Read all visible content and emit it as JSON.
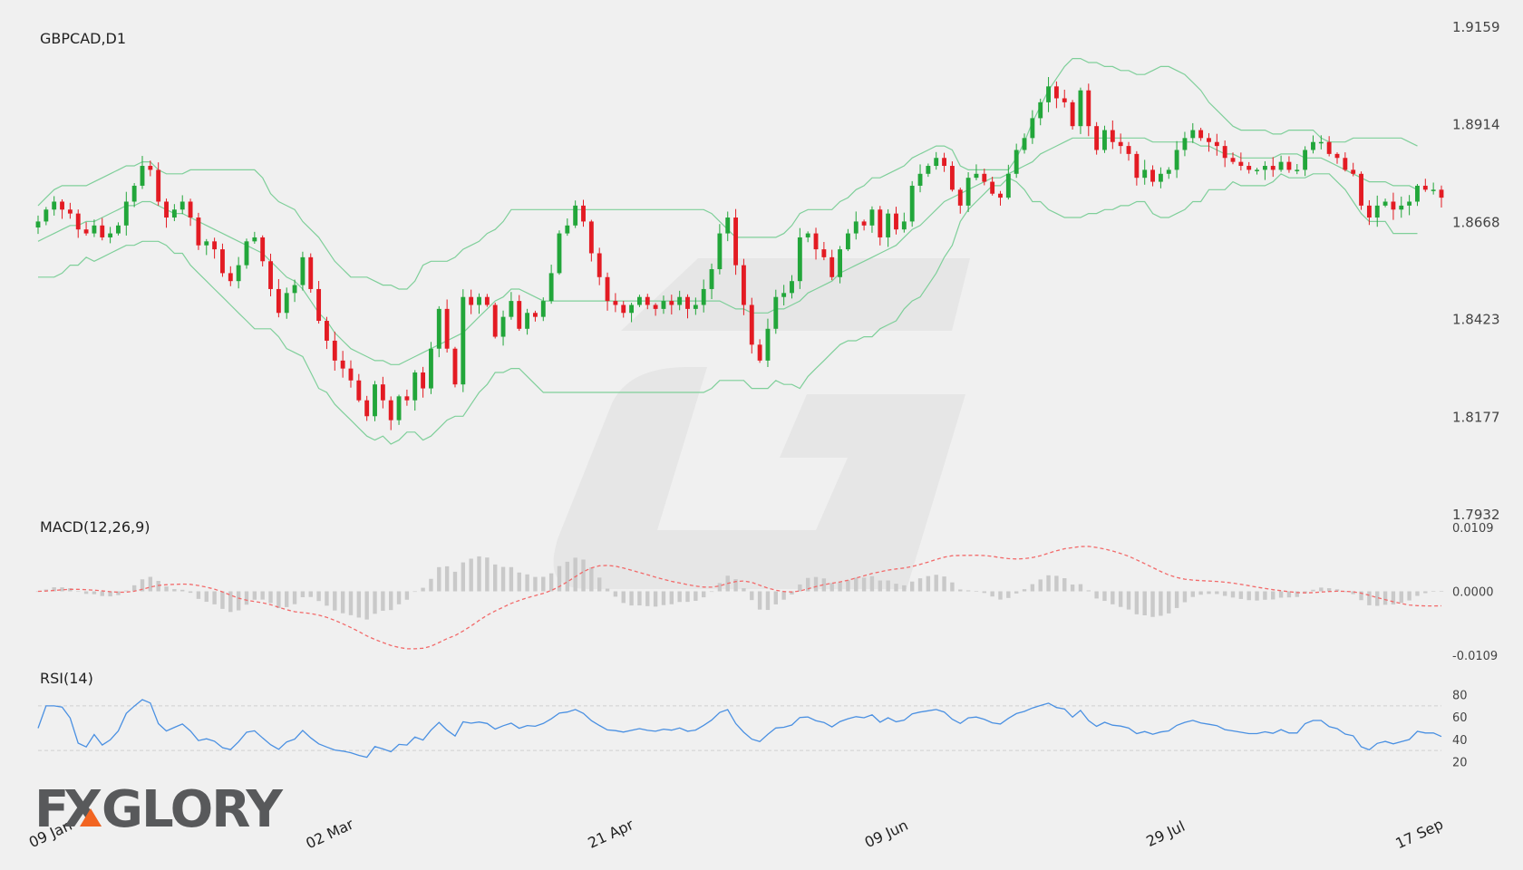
{
  "chart_data": {
    "type": "candlestick",
    "title": "GBPCAD,D1",
    "price_axis": {
      "ticks": [
        "1.9159",
        "1.8914",
        "1.8668",
        "1.8423",
        "1.8177",
        "1.7932"
      ],
      "ylim": [
        1.7932,
        1.9159
      ]
    },
    "x_ticks": [
      "09 Jan",
      "02 Mar",
      "21 Apr",
      "09 Jun",
      "29 Jul",
      "17 Sep"
    ],
    "series": [
      {
        "name": "close",
        "values": [
          1.867,
          1.87,
          1.872,
          1.87,
          1.869,
          1.865,
          1.864,
          1.866,
          1.863,
          1.864,
          1.866,
          1.872,
          1.876,
          1.881,
          1.88,
          1.872,
          1.868,
          1.87,
          1.872,
          1.868,
          1.861,
          1.862,
          1.86,
          1.854,
          1.852,
          1.856,
          1.862,
          1.863,
          1.857,
          1.85,
          1.844,
          1.849,
          1.851,
          1.858,
          1.85,
          1.842,
          1.837,
          1.832,
          1.83,
          1.827,
          1.822,
          1.818,
          1.826,
          1.822,
          1.817,
          1.823,
          1.822,
          1.829,
          1.825,
          1.835,
          1.845,
          1.835,
          1.826,
          1.848,
          1.846,
          1.848,
          1.846,
          1.838,
          1.843,
          1.847,
          1.84,
          1.844,
          1.843,
          1.847,
          1.854,
          1.864,
          1.866,
          1.871,
          1.867,
          1.859,
          1.853,
          1.847,
          1.846,
          1.844,
          1.846,
          1.848,
          1.846,
          1.845,
          1.847,
          1.846,
          1.848,
          1.845,
          1.846,
          1.85,
          1.855,
          1.864,
          1.868,
          1.856,
          1.846,
          1.836,
          1.832,
          1.84,
          1.848,
          1.849,
          1.852,
          1.863,
          1.864,
          1.86,
          1.858,
          1.853,
          1.86,
          1.864,
          1.867,
          1.866,
          1.87,
          1.863,
          1.869,
          1.865,
          1.867,
          1.876,
          1.879,
          1.881,
          1.883,
          1.881,
          1.875,
          1.871,
          1.878,
          1.879,
          1.877,
          1.874,
          1.873,
          1.879,
          1.885,
          1.888,
          1.893,
          1.897,
          1.901,
          1.898,
          1.897,
          1.891,
          1.9,
          1.891,
          1.885,
          1.89,
          1.887,
          1.886,
          1.884,
          1.878,
          1.88,
          1.877,
          1.879,
          1.88,
          1.885,
          1.888,
          1.89,
          1.888,
          1.887,
          1.886,
          1.883,
          1.882,
          1.881,
          1.88,
          1.88,
          1.881,
          1.88,
          1.882,
          1.88,
          1.88,
          1.885,
          1.887,
          1.887,
          1.884,
          1.883,
          1.88,
          1.879,
          1.871,
          1.868,
          1.871,
          1.872,
          1.87,
          1.871,
          1.872,
          1.876,
          1.875,
          1.875,
          1.873
        ]
      }
    ],
    "bollinger_bands": {
      "upper": [
        1.871,
        1.873,
        1.875,
        1.876,
        1.876,
        1.876,
        1.876,
        1.877,
        1.878,
        1.879,
        1.88,
        1.881,
        1.881,
        1.882,
        1.882,
        1.88,
        1.879,
        1.879,
        1.879,
        1.88,
        1.88,
        1.88,
        1.88,
        1.88,
        1.88,
        1.88,
        1.88,
        1.88,
        1.878,
        1.874,
        1.872,
        1.871,
        1.87,
        1.867,
        1.865,
        1.863,
        1.86,
        1.857,
        1.855,
        1.853,
        1.853,
        1.853,
        1.852,
        1.851,
        1.851,
        1.85,
        1.85,
        1.852,
        1.856,
        1.857,
        1.857,
        1.857,
        1.858,
        1.86,
        1.861,
        1.862,
        1.864,
        1.865,
        1.867,
        1.87,
        1.87,
        1.87,
        1.87,
        1.87,
        1.87,
        1.87,
        1.87,
        1.87,
        1.87,
        1.87,
        1.87,
        1.87,
        1.87,
        1.87,
        1.87,
        1.87,
        1.87,
        1.87,
        1.87,
        1.87,
        1.87,
        1.87,
        1.87,
        1.87,
        1.869,
        1.867,
        1.865,
        1.863,
        1.863,
        1.863,
        1.863,
        1.863,
        1.863,
        1.864,
        1.866,
        1.869,
        1.87,
        1.87,
        1.87,
        1.87,
        1.872,
        1.873,
        1.875,
        1.876,
        1.878,
        1.878,
        1.879,
        1.88,
        1.881,
        1.883,
        1.884,
        1.885,
        1.886,
        1.886,
        1.885,
        1.881,
        1.88,
        1.88,
        1.88,
        1.88,
        1.88,
        1.88,
        1.883,
        1.887,
        1.892,
        1.896,
        1.9,
        1.903,
        1.906,
        1.908,
        1.908,
        1.907,
        1.907,
        1.906,
        1.906,
        1.905,
        1.905,
        1.904,
        1.904,
        1.905,
        1.906,
        1.906,
        1.905,
        1.904,
        1.902,
        1.9,
        1.897,
        1.895,
        1.893,
        1.891,
        1.89,
        1.89,
        1.89,
        1.89,
        1.889,
        1.889,
        1.89,
        1.89,
        1.89,
        1.89,
        1.888,
        1.887,
        1.887,
        1.887,
        1.888,
        1.888,
        1.888,
        1.888,
        1.888,
        1.888,
        1.888,
        1.887,
        1.886
      ],
      "middle": [
        1.862,
        1.863,
        1.864,
        1.865,
        1.866,
        1.866,
        1.867,
        1.867,
        1.868,
        1.869,
        1.87,
        1.871,
        1.871,
        1.872,
        1.872,
        1.871,
        1.87,
        1.869,
        1.869,
        1.868,
        1.867,
        1.866,
        1.865,
        1.864,
        1.863,
        1.862,
        1.861,
        1.86,
        1.859,
        1.857,
        1.855,
        1.853,
        1.852,
        1.85,
        1.847,
        1.844,
        1.842,
        1.839,
        1.837,
        1.835,
        1.834,
        1.833,
        1.832,
        1.832,
        1.831,
        1.831,
        1.832,
        1.833,
        1.834,
        1.835,
        1.836,
        1.837,
        1.838,
        1.839,
        1.841,
        1.843,
        1.845,
        1.847,
        1.848,
        1.85,
        1.85,
        1.849,
        1.848,
        1.847,
        1.847,
        1.847,
        1.847,
        1.847,
        1.847,
        1.847,
        1.847,
        1.847,
        1.847,
        1.847,
        1.847,
        1.847,
        1.847,
        1.847,
        1.847,
        1.847,
        1.847,
        1.847,
        1.847,
        1.847,
        1.847,
        1.847,
        1.846,
        1.845,
        1.845,
        1.844,
        1.844,
        1.844,
        1.845,
        1.845,
        1.846,
        1.847,
        1.849,
        1.85,
        1.851,
        1.852,
        1.854,
        1.855,
        1.856,
        1.857,
        1.858,
        1.859,
        1.86,
        1.861,
        1.863,
        1.865,
        1.866,
        1.868,
        1.87,
        1.872,
        1.873,
        1.874,
        1.875,
        1.876,
        1.877,
        1.878,
        1.878,
        1.879,
        1.88,
        1.881,
        1.882,
        1.884,
        1.885,
        1.886,
        1.887,
        1.888,
        1.888,
        1.888,
        1.888,
        1.888,
        1.888,
        1.888,
        1.888,
        1.888,
        1.888,
        1.887,
        1.887,
        1.887,
        1.887,
        1.887,
        1.887,
        1.886,
        1.886,
        1.885,
        1.884,
        1.884,
        1.883,
        1.883,
        1.883,
        1.883,
        1.883,
        1.884,
        1.884,
        1.884,
        1.883,
        1.883,
        1.883,
        1.882,
        1.881,
        1.88,
        1.879,
        1.878,
        1.877,
        1.877,
        1.877,
        1.876,
        1.876,
        1.876,
        1.875
      ],
      "lower": [
        1.853,
        1.853,
        1.853,
        1.854,
        1.856,
        1.856,
        1.858,
        1.857,
        1.858,
        1.859,
        1.86,
        1.861,
        1.861,
        1.862,
        1.862,
        1.862,
        1.861,
        1.859,
        1.859,
        1.856,
        1.854,
        1.852,
        1.85,
        1.848,
        1.846,
        1.844,
        1.842,
        1.84,
        1.84,
        1.84,
        1.838,
        1.835,
        1.834,
        1.833,
        1.829,
        1.825,
        1.824,
        1.821,
        1.819,
        1.817,
        1.815,
        1.813,
        1.812,
        1.813,
        1.811,
        1.812,
        1.814,
        1.814,
        1.812,
        1.813,
        1.815,
        1.817,
        1.818,
        1.818,
        1.821,
        1.824,
        1.826,
        1.829,
        1.829,
        1.83,
        1.83,
        1.828,
        1.826,
        1.824,
        1.824,
        1.824,
        1.824,
        1.824,
        1.824,
        1.824,
        1.824,
        1.824,
        1.824,
        1.824,
        1.824,
        1.824,
        1.824,
        1.824,
        1.824,
        1.824,
        1.824,
        1.824,
        1.824,
        1.824,
        1.825,
        1.827,
        1.827,
        1.827,
        1.827,
        1.825,
        1.825,
        1.825,
        1.827,
        1.826,
        1.826,
        1.825,
        1.828,
        1.83,
        1.832,
        1.834,
        1.836,
        1.837,
        1.837,
        1.838,
        1.838,
        1.84,
        1.841,
        1.842,
        1.845,
        1.847,
        1.848,
        1.851,
        1.854,
        1.858,
        1.861,
        1.867,
        1.87,
        1.872,
        1.874,
        1.876,
        1.876,
        1.878,
        1.877,
        1.875,
        1.872,
        1.872,
        1.87,
        1.869,
        1.868,
        1.868,
        1.868,
        1.869,
        1.869,
        1.87,
        1.87,
        1.871,
        1.871,
        1.872,
        1.872,
        1.869,
        1.868,
        1.868,
        1.869,
        1.87,
        1.872,
        1.872,
        1.875,
        1.875,
        1.875,
        1.877,
        1.876,
        1.876,
        1.876,
        1.876,
        1.877,
        1.879,
        1.878,
        1.878,
        1.878,
        1.879,
        1.879,
        1.879,
        1.877,
        1.875,
        1.872,
        1.869,
        1.867,
        1.867,
        1.867,
        1.864,
        1.864,
        1.864,
        1.864
      ]
    },
    "macd": {
      "title": "MACD(12,26,9)",
      "ticks": [
        "0.0109",
        "0.0000",
        "-0.0109"
      ],
      "ylim": [
        -0.0109,
        0.0109
      ]
    },
    "rsi": {
      "title": "RSI(14)",
      "ticks": [
        "80",
        "60",
        "40",
        "20"
      ],
      "ylim": [
        0,
        100
      ]
    }
  },
  "branding": {
    "logo_text_prefix": "F",
    "logo_text_mid": "X",
    "logo_text_suffix": "GLORY"
  }
}
